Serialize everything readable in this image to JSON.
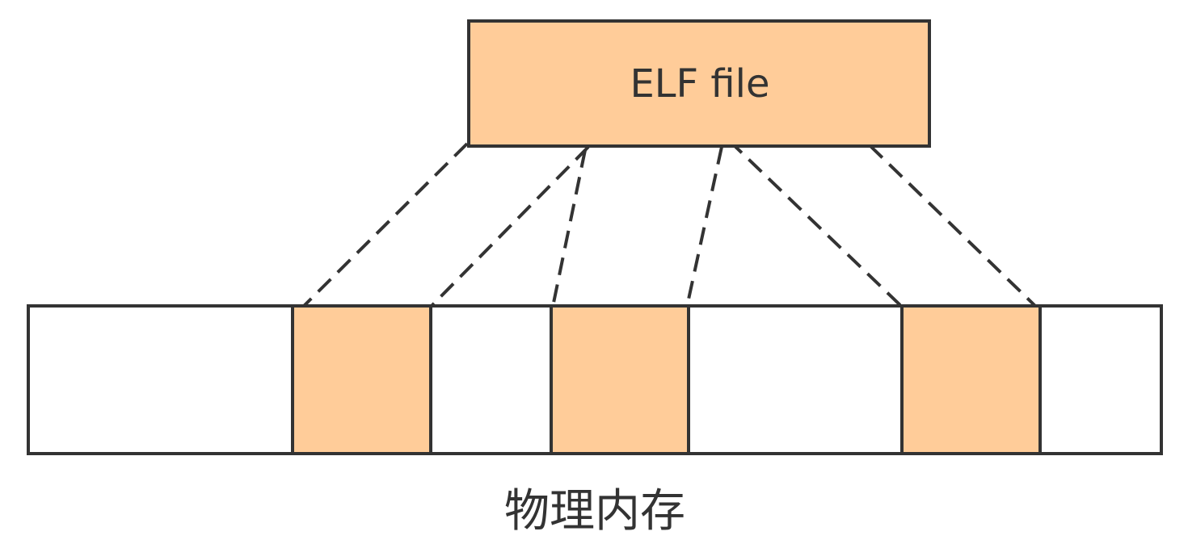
{
  "diagram": {
    "file_box": {
      "label": "ELF file"
    },
    "memory": {
      "caption": "物理内存",
      "blocks": [
        {
          "filled": false
        },
        {
          "filled": true
        },
        {
          "filled": false
        },
        {
          "filled": true
        },
        {
          "filled": false
        },
        {
          "filled": true
        },
        {
          "filled": false
        }
      ]
    },
    "colors": {
      "fill": "#ffcc99",
      "stroke": "#333333",
      "empty": "#ffffff"
    }
  }
}
